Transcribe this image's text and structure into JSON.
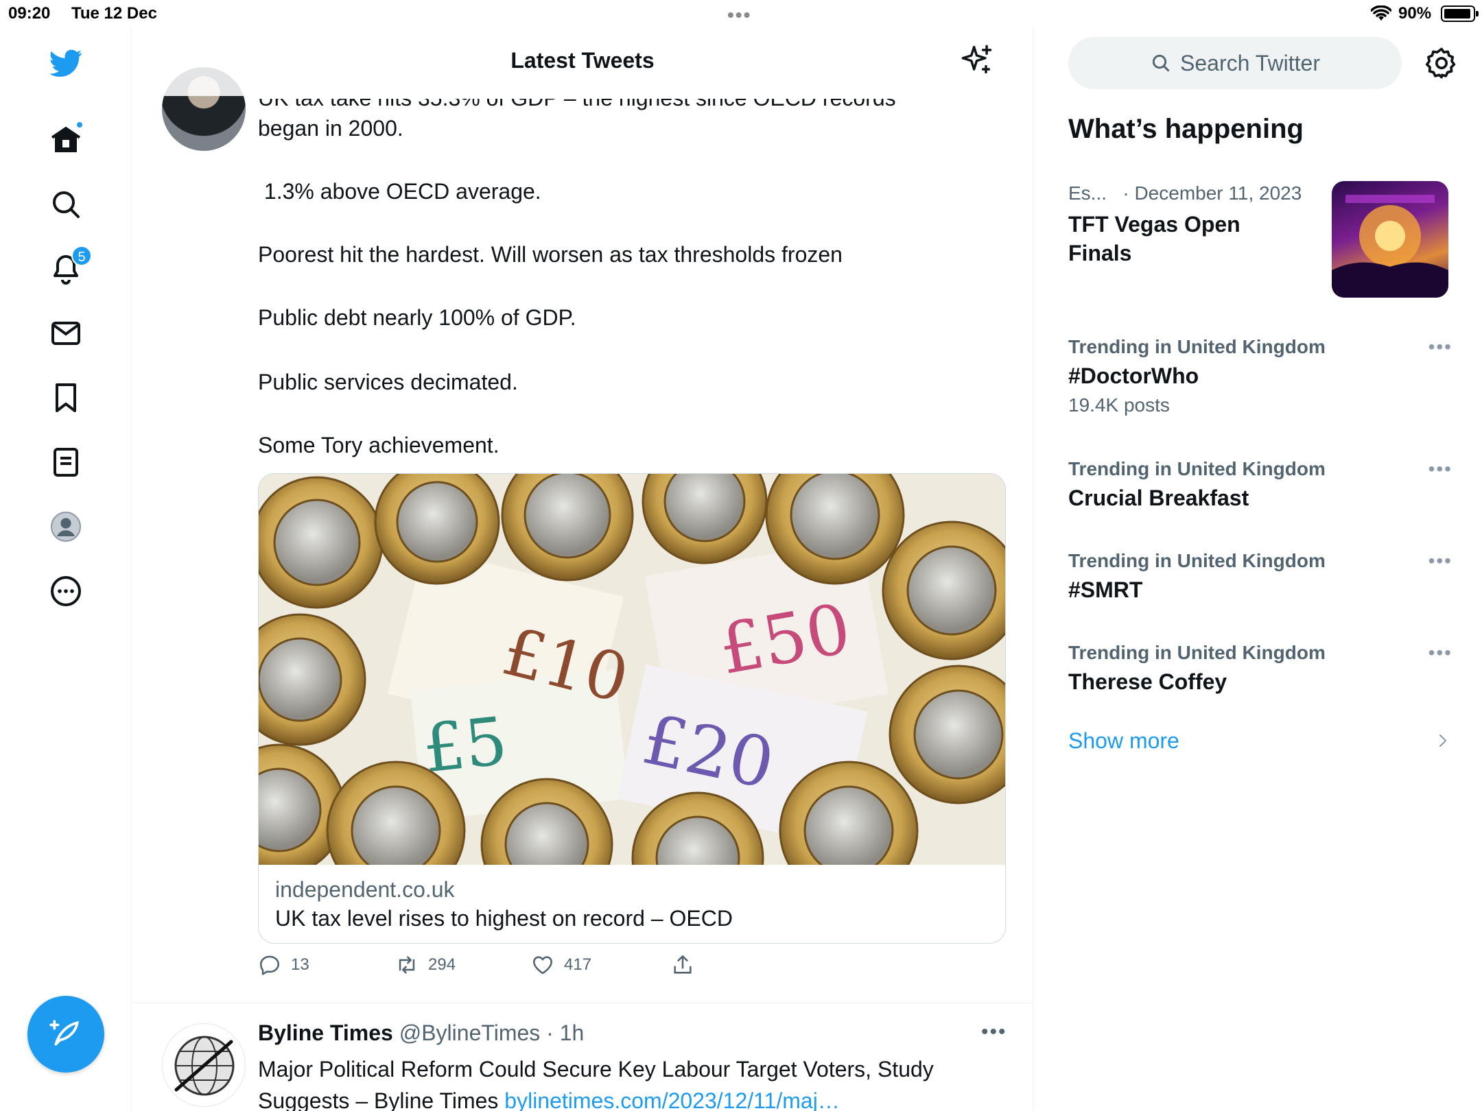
{
  "status_bar": {
    "time": "09:20",
    "date": "Tue 12 Dec",
    "battery": "90%"
  },
  "nav": {
    "notifications_count": "5"
  },
  "header": {
    "title": "Latest Tweets"
  },
  "tweet1": {
    "lines": [
      "UK tax take hits 35.3% of GDP – the highest since OECD records",
      "began in 2000.",
      " 1.3% above OECD average.",
      "Poorest hit the hardest. Will worsen as tax thresholds frozen",
      "Public debt nearly 100% of GDP.",
      "Public services decimated.",
      "Some Tory achievement."
    ],
    "card": {
      "image_notes": [
        "£10",
        "£50",
        "£5",
        "£20"
      ],
      "domain": "independent.co.uk",
      "title": "UK tax level rises to highest on record – OECD"
    },
    "stats": {
      "replies": "13",
      "retweets": "294",
      "likes": "417"
    }
  },
  "tweet2": {
    "name": "Byline Times",
    "handle_time": " @BylineTimes · 1h",
    "text": "Major Political Reform Could Secure Key Labour Target Voters, Study Suggests – Byline Times ",
    "link": "bylinetimes.com/2023/12/11/maj…"
  },
  "sidebar": {
    "search_placeholder": "Search Twitter",
    "heading": "What’s happening",
    "event": {
      "category": "Es...",
      "date": "· December 11, 2023",
      "title": "TFT Vegas Open Finals"
    },
    "trends": [
      {
        "context": "Trending in United Kingdom",
        "name": "#DoctorWho",
        "posts": "19.4K posts"
      },
      {
        "context": "Trending in United Kingdom",
        "name": "Crucial Breakfast",
        "posts": ""
      },
      {
        "context": "Trending in United Kingdom",
        "name": "#SMRT",
        "posts": ""
      },
      {
        "context": "Trending in United Kingdom",
        "name": "Therese Coffey",
        "posts": ""
      }
    ],
    "show_more": "Show more"
  },
  "colors": {
    "accent": "#1d9bf0",
    "text": "#0f1419",
    "muted": "#536471"
  }
}
